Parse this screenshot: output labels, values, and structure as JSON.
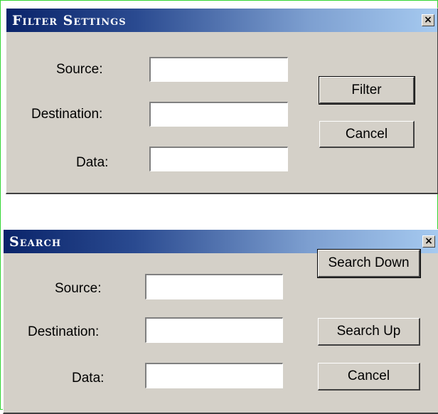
{
  "filter_dialog": {
    "title": "Filter Settings",
    "close_glyph": "×",
    "fields": [
      {
        "label": "Source:",
        "value": ""
      },
      {
        "label": "Destination:",
        "value": ""
      },
      {
        "label": "Data:",
        "value": ""
      }
    ],
    "buttons": {
      "filter": "Filter",
      "cancel": "Cancel"
    }
  },
  "search_dialog": {
    "title": "Search",
    "close_glyph": "×",
    "fields": [
      {
        "label": "Source:",
        "value": ""
      },
      {
        "label": "Destination:",
        "value": ""
      },
      {
        "label": "Data:",
        "value": ""
      }
    ],
    "buttons": {
      "search_down": "Search Down",
      "search_up": "Search Up",
      "cancel": "Cancel"
    }
  },
  "icons": {
    "close": "close-icon"
  },
  "colors": {
    "frame_border": "#33d633",
    "dialog_face": "#d4d0c8",
    "titlebar_start": "#0a246a",
    "titlebar_end": "#a6caf0"
  }
}
